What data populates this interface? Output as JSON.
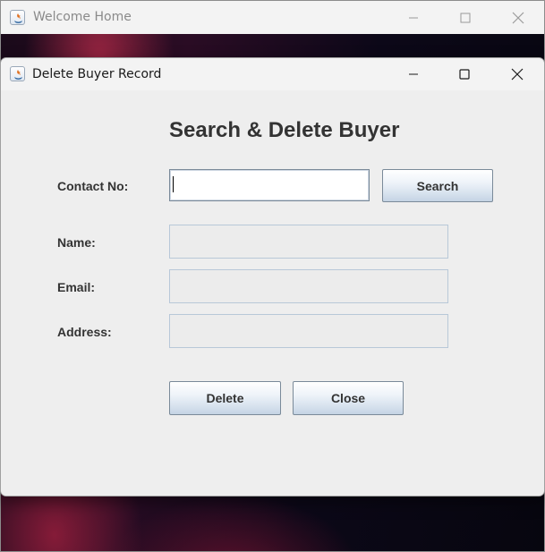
{
  "background_window": {
    "title": "Welcome Home"
  },
  "dialog": {
    "title": "Delete Buyer Record",
    "heading": "Search & Delete Buyer",
    "contact": {
      "label": "Contact No:",
      "value": ""
    },
    "search_button": "Search",
    "fields": [
      {
        "label": "Name:",
        "value": ""
      },
      {
        "label": "Email:",
        "value": ""
      },
      {
        "label": "Address:",
        "value": ""
      }
    ],
    "delete_button": "Delete",
    "close_button": "Close"
  },
  "icons": {
    "app": "java-app-icon",
    "minimize": "minimize-icon",
    "maximize": "maximize-icon",
    "close": "close-icon"
  },
  "colors": {
    "dialog_bg": "#eeeeee",
    "titlebar_bg": "#f3f3f3",
    "text": "#333333",
    "button_gradient_bottom": "#c4d3e4"
  }
}
